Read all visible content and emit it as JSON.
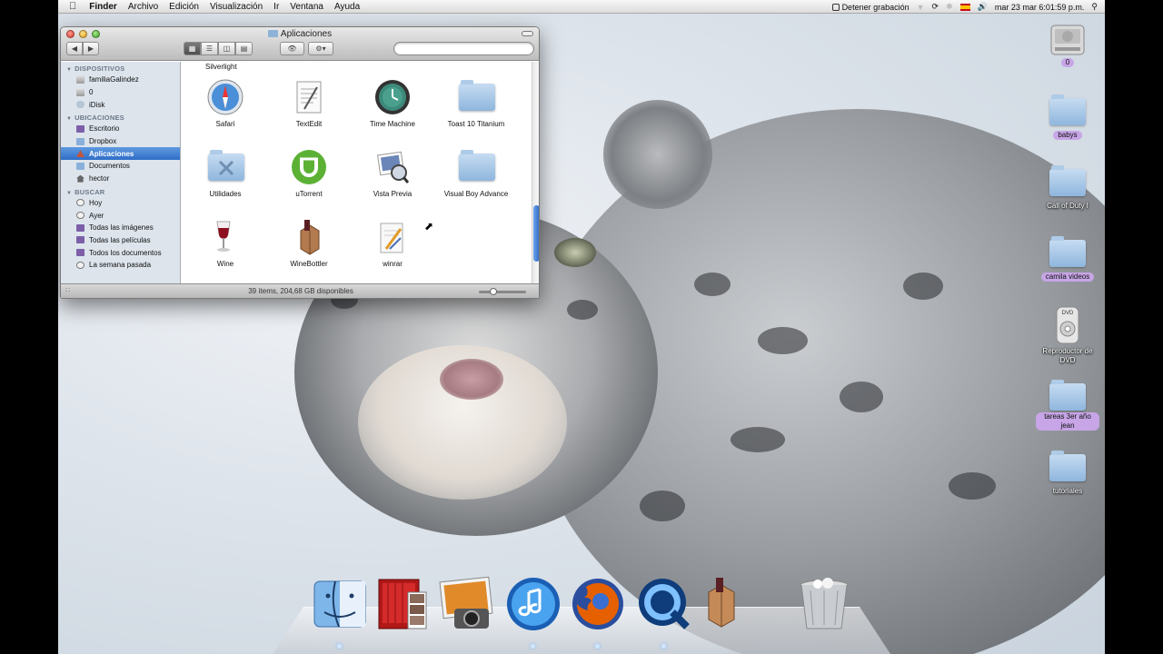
{
  "menubar": {
    "apple_icon": "apple-logo-icon",
    "app_name": "Finder",
    "menus": [
      "Archivo",
      "Edición",
      "Visualización",
      "Ir",
      "Ventana",
      "Ayuda"
    ],
    "recording_label": "Detener grabación",
    "datetime": "mar 23 mar  6:01:59 p.m."
  },
  "window": {
    "title": "Aplicaciones",
    "status": "39 ítems, 204,68 GB disponibles",
    "search": {
      "value": "",
      "placeholder": ""
    }
  },
  "sidebar": {
    "sections": [
      {
        "title": "DISPOSITIVOS",
        "items": [
          "familiaGalindez",
          "0",
          "iDisk"
        ]
      },
      {
        "title": "UBICACIONES",
        "items": [
          "Escritorio",
          "Dropbox",
          "Aplicaciones",
          "Documentos",
          "hector"
        ]
      },
      {
        "title": "BUSCAR",
        "items": [
          "Hoy",
          "Ayer",
          "Todas las imágenes",
          "Todas las películas",
          "Todos los documentos",
          "La semana pasada"
        ]
      }
    ],
    "selected": "Aplicaciones"
  },
  "content": {
    "partial_label": "Silverlight",
    "apps": [
      {
        "name": "Safari",
        "icon": "safari-icon"
      },
      {
        "name": "TextEdit",
        "icon": "textedit-icon"
      },
      {
        "name": "Time Machine",
        "icon": "time-machine-icon"
      },
      {
        "name": "Toast 10 Titanium",
        "icon": "folder-icon"
      },
      {
        "name": "Utilidades",
        "icon": "utilities-folder-icon"
      },
      {
        "name": "uTorrent",
        "icon": "utorrent-icon"
      },
      {
        "name": "Vista Previa",
        "icon": "preview-icon"
      },
      {
        "name": "Visual Boy Advance",
        "icon": "folder-icon"
      },
      {
        "name": "Wine",
        "icon": "wine-icon"
      },
      {
        "name": "WineBottler",
        "icon": "winebottler-icon"
      },
      {
        "name": "winrar",
        "icon": "winrar-icon"
      }
    ]
  },
  "desktop": {
    "items": [
      {
        "label": "0",
        "icon": "hard-drive-icon"
      },
      {
        "label": "babys",
        "icon": "folder-icon"
      },
      {
        "label": "Call of Duty I",
        "icon": "folder-icon"
      },
      {
        "label": "camila videos",
        "icon": "folder-icon"
      },
      {
        "label": "Reproductor de DVD",
        "icon": "dvd-player-icon"
      },
      {
        "label": "tareas 3er año jean",
        "icon": "folder-icon"
      },
      {
        "label": "tutoriales",
        "icon": "folder-icon"
      }
    ]
  },
  "dock": {
    "items": [
      "finder-icon",
      "photo-booth-icon",
      "iphoto-icon",
      "itunes-icon",
      "firefox-icon",
      "quicktime-icon",
      "winebottler-icon",
      "trash-icon"
    ]
  },
  "colors": {
    "selection": "#3b78d0",
    "sidebar_bg": "#dde4ec",
    "label_purple": "#c7a5e6"
  }
}
